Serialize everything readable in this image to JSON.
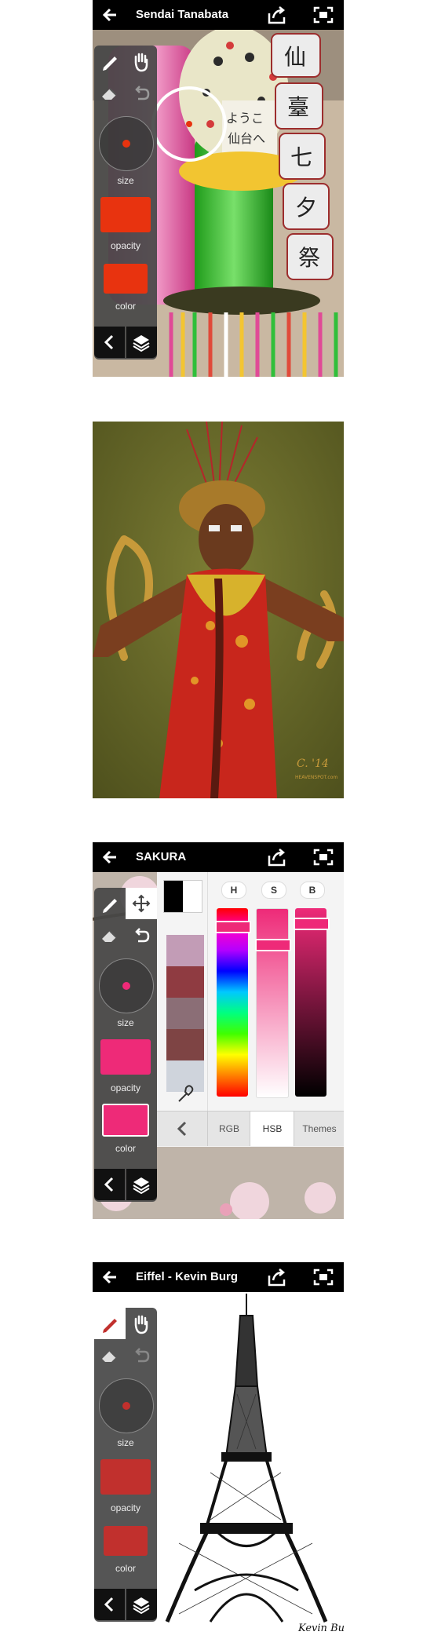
{
  "screens": [
    {
      "title": "Sendai Tanabata",
      "tools": {
        "size_label": "size",
        "opacity_label": "opacity",
        "color_label": "color"
      },
      "brush_color": "#e8330f",
      "photo_text": "ようこそ仙台へ",
      "lantern_text": [
        "仙",
        "臺",
        "七",
        "夕",
        "祭"
      ]
    },
    {
      "signature": "C. '14",
      "watermark": "HEAVENSPOT.com"
    },
    {
      "title": "SAKURA",
      "tools": {
        "size_label": "size",
        "opacity_label": "opacity",
        "color_label": "color"
      },
      "brush_color": "#ee2a78",
      "picker": {
        "channels": [
          "H",
          "S",
          "B"
        ],
        "tabs": [
          "RGB",
          "HSB",
          "Themes"
        ],
        "active_tab": "HSB",
        "palette": [
          "#c29cb6",
          "#8f3b41",
          "#8b6e76",
          "#7e4444",
          "#cfd4dc"
        ]
      }
    },
    {
      "title": "Eiffel - Kevin Burg",
      "tools": {
        "size_label": "size",
        "opacity_label": "opacity",
        "color_label": "color"
      },
      "brush_color": "#c1302d",
      "signature": "Kevin Burg"
    }
  ]
}
